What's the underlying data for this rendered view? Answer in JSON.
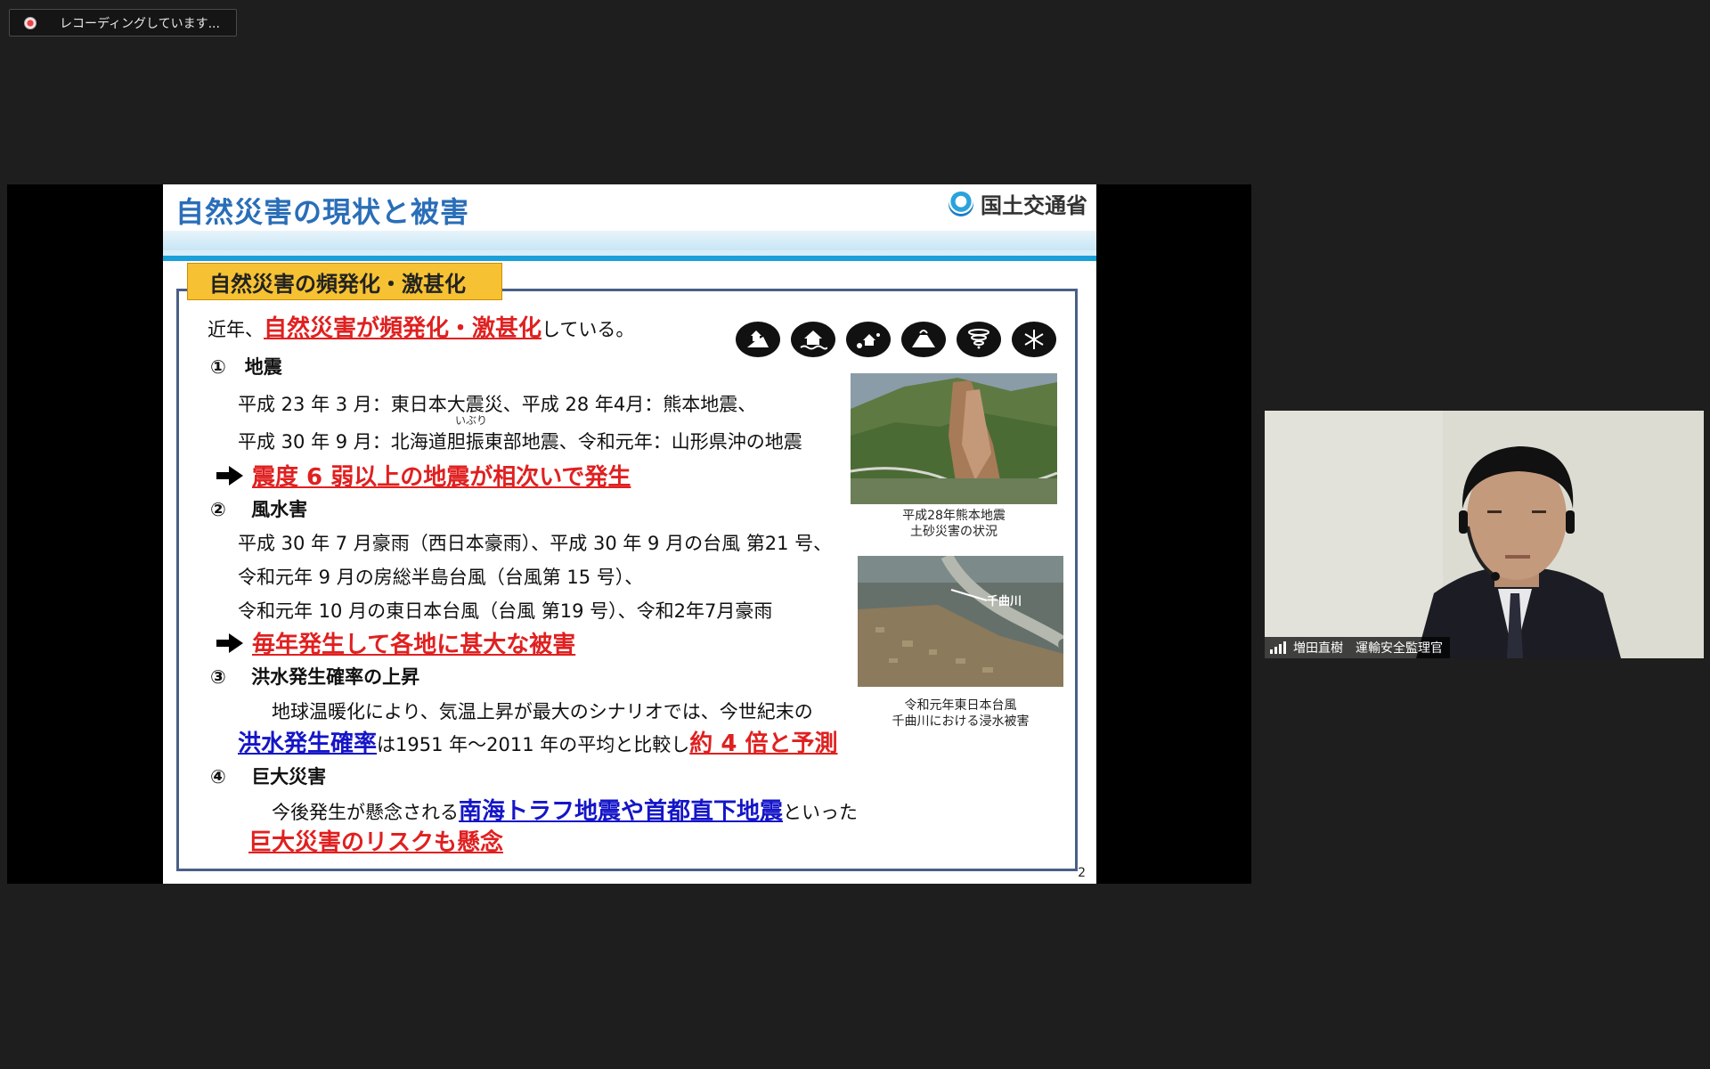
{
  "recording": {
    "label": "レコーディングしています..."
  },
  "slide": {
    "title": "自然災害の現状と被害",
    "logo_text": "国土交通省",
    "section_label": "自然災害の頻発化・激甚化",
    "intro": {
      "prefix": "近年、",
      "highlight": "自然災害が頻発化・激甚化",
      "suffix": "している。"
    },
    "hazard_icons": [
      "landslide-icon",
      "flood-house-icon",
      "debris-flow-icon",
      "volcano-icon",
      "tornado-icon",
      "snow-icon"
    ],
    "sections": {
      "earthquake": {
        "heading": "①　地震",
        "line1": "平成 23 年 3 月：東日本大震災、平成 28 年4月：熊本地震、",
        "ruby": "いぶり",
        "line2": "平成 30 年 9 月：北海道胆振東部地震、令和元年：山形県沖の地震",
        "conclusion": "震度 6 弱以上の地震が相次いで発生"
      },
      "storm_flood": {
        "heading": "②　 風水害",
        "line1": "平成 30 年 7 月豪雨（西日本豪雨）、平成 30 年 9 月の台風 第21 号、",
        "line2": "令和元年 9 月の房総半島台風（台風第 15 号）、",
        "line3": "令和元年 10 月の東日本台風（台風 第19 号）、令和2年7月豪雨",
        "conclusion": "毎年発生して各地に甚大な被害"
      },
      "flood_probability": {
        "heading": "③　 洪水発生確率の上昇",
        "line1": "地球温暖化により、気温上昇が最大のシナリオでは、今世紀末の",
        "line2_highlight": "洪水発生確率",
        "line2_mid": "は1951 年～2011 年の平均と比較し",
        "line2_red": "約 4 倍と予測"
      },
      "mega_disaster": {
        "heading": "④　 巨大災害",
        "line1_prefix": "今後発生が懸念される",
        "line1_highlight": "南海トラフ地震や首都直下地震",
        "line1_suffix": "といった",
        "conclusion": "巨大災害のリスクも懸念"
      }
    },
    "photo1": {
      "caption_line1": "平成28年熊本地震",
      "caption_line2": "土砂災害の状況"
    },
    "photo2": {
      "overlay_label": "千曲川",
      "caption_line1": "令和元年東日本台風",
      "caption_line2": "千曲川における浸水被害"
    },
    "page_number": "2"
  },
  "webcam": {
    "name_label": "増田直樹　運輸安全監理官"
  }
}
